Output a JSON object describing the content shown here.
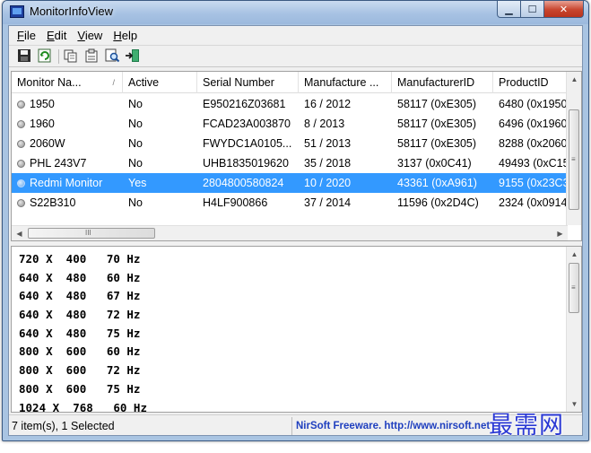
{
  "window": {
    "title": "MonitorInfoView"
  },
  "menu": [
    {
      "key": "file",
      "first": "F",
      "rest": "ile"
    },
    {
      "key": "edit",
      "first": "E",
      "rest": "dit"
    },
    {
      "key": "view",
      "first": "V",
      "rest": "iew"
    },
    {
      "key": "help",
      "first": "H",
      "rest": "elp"
    }
  ],
  "toolbar": {
    "icons": [
      "save-icon",
      "refresh-icon",
      "copy-icon",
      "properties-icon",
      "find-icon",
      "exit-icon"
    ]
  },
  "table": {
    "columns": [
      "Monitor Na...",
      "Active",
      "Serial Number",
      "Manufacture ...",
      "ManufacturerID",
      "ProductID"
    ],
    "sort_indicator": "/",
    "rows": [
      {
        "name": "1950",
        "active": "No",
        "serial": "E950216Z03681",
        "manufacture": "16 / 2012",
        "manufacturer_id": "58117 (0xE305)",
        "product_id": "6480 (0x1950)"
      },
      {
        "name": "1960",
        "active": "No",
        "serial": "FCAD23A003870",
        "manufacture": "8 / 2013",
        "manufacturer_id": "58117 (0xE305)",
        "product_id": "6496 (0x1960)"
      },
      {
        "name": "2060W",
        "active": "No",
        "serial": "FWYDC1A0105...",
        "manufacture": "51 / 2013",
        "manufacturer_id": "58117 (0xE305)",
        "product_id": "8288 (0x2060)"
      },
      {
        "name": "PHL 243V7",
        "active": "No",
        "serial": "UHB1835019620",
        "manufacture": "35 / 2018",
        "manufacturer_id": "3137 (0x0C41)",
        "product_id": "49493 (0xC15"
      },
      {
        "name": "Redmi Monitor",
        "active": "Yes",
        "serial": "2804800580824",
        "manufacture": "10 / 2020",
        "manufacturer_id": "43361 (0xA961)",
        "product_id": "9155 (0x23C3"
      },
      {
        "name": "S22B310",
        "active": "No",
        "serial": "H4LF900866",
        "manufacture": "37 / 2014",
        "manufacturer_id": "11596 (0x2D4C)",
        "product_id": "2324 (0x0914)"
      }
    ],
    "selected_index": 4,
    "hscroll_grip": "III",
    "vscroll_grip": "≡"
  },
  "modes": [
    "720 X  400   70 Hz",
    "640 X  480   60 Hz",
    "640 X  480   67 Hz",
    "640 X  480   72 Hz",
    "640 X  480   75 Hz",
    "800 X  600   60 Hz",
    "800 X  600   72 Hz",
    "800 X  600   75 Hz",
    "1024 X  768   60 Hz"
  ],
  "status": {
    "items": "7 item(s), 1 Selected",
    "link": "NirSoft Freeware.  http://www.nirsoft.net"
  },
  "watermark": "最需网"
}
